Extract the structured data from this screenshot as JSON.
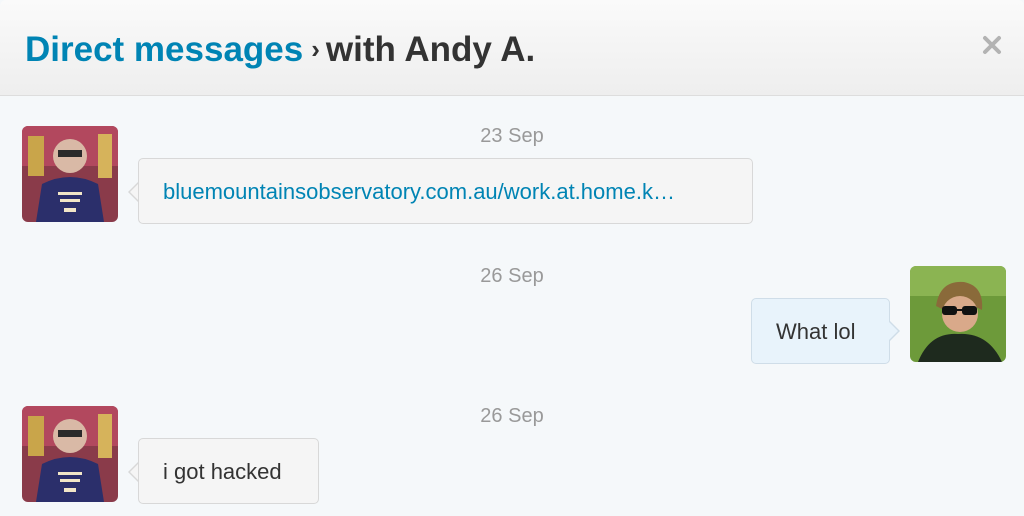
{
  "header": {
    "breadcrumb_link": "Direct messages",
    "separator": "›",
    "conversation_title": "with Andy A.",
    "close_icon": "close-icon"
  },
  "messages": [
    {
      "date": "23 Sep",
      "direction": "incoming",
      "text": "bluemountainsobservatory.com.au/work.at.home.k…",
      "is_link": true
    },
    {
      "date": "26 Sep",
      "direction": "outgoing",
      "text": "What lol",
      "is_link": false
    },
    {
      "date": "26 Sep",
      "direction": "incoming",
      "text": "i got hacked",
      "is_link": false
    }
  ],
  "colors": {
    "link": "#0084b4",
    "date": "#999999",
    "background": "#f5f8fa",
    "outgoing_bubble": "#e8f3fb",
    "incoming_bubble": "#f5f5f5"
  }
}
